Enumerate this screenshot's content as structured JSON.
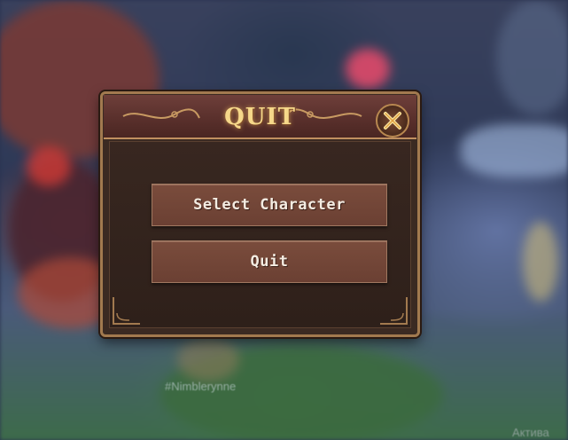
{
  "dialog": {
    "title": "QUIT",
    "close_icon": "close-x-icon",
    "buttons": [
      {
        "label": "Select Character"
      },
      {
        "label": "Quit"
      }
    ]
  },
  "background": {
    "player_name": "#Nimblerynne",
    "watermark": "Актива"
  },
  "colors": {
    "title_gold": "#f6d88a",
    "button_fill": "#6b4033",
    "frame_gold": "#a27a4f",
    "panel_dark": "#2e201a"
  }
}
